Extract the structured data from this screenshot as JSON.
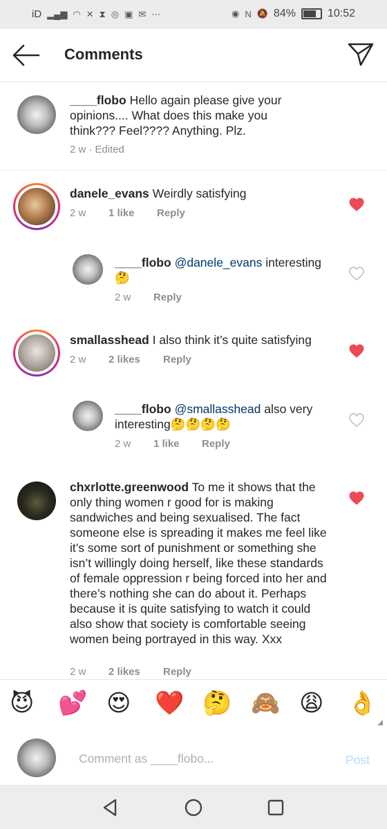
{
  "status_bar": {
    "left_text": "iD",
    "battery_percent": "84%",
    "time": "10:52",
    "battery_level": 0.84
  },
  "header": {
    "title": "Comments"
  },
  "caption": {
    "username": "____flobo",
    "text": "Hello again please give your opinions.... What does this make you think??? Feel???? Anything. Plz.",
    "time": "2 w",
    "edited": "Edited",
    "separator": "·"
  },
  "comments": [
    {
      "username": "danele_evans",
      "text": "Weirdly satisfying",
      "time": "2 w",
      "likes": "1 like",
      "reply": "Reply",
      "liked": true
    },
    {
      "username": "____flobo",
      "mention": "@danele_evans",
      "text": "interesting",
      "emoji": "🤔",
      "time": "2 w",
      "reply": "Reply",
      "liked": false
    },
    {
      "username": "smallasshead",
      "text": "I also think it’s quite satisfying",
      "time": "2 w",
      "likes": "2 likes",
      "reply": "Reply",
      "liked": true
    },
    {
      "username": "____flobo",
      "mention": "@smallasshead",
      "text": "also very interesting",
      "emoji": "🤔🤔🤔🤔",
      "time": "2 w",
      "likes": "1 like",
      "reply": "Reply",
      "liked": false
    },
    {
      "username": "chxrlotte.greenwood",
      "text": "To me it shows that the only thing women r good for is making sandwiches and being sexualised. The fact someone else is spreading it makes me feel like it’s some sort of punishment or something she isn’t willingly doing herself, like these standards of female oppression r being forced into her and there’s nothing she can do about it. Perhaps because it is quite satisfying to watch it could also show that society is comfortable seeing women being portrayed in this way. Xxx",
      "time": "2 w",
      "likes": "2 likes",
      "reply": "Reply",
      "liked": true
    }
  ],
  "emoji_bar": [
    "😈",
    "💕",
    "😍",
    "❤️",
    "🤔",
    "🙈",
    "😩",
    "👌"
  ],
  "composer": {
    "placeholder": "Comment as ____flobo...",
    "post_label": "Post"
  },
  "colors": {
    "heart_liked": "#ed4956",
    "heart_unliked": "#c7c7c7",
    "mention": "#00376b",
    "post_disabled": "#b3dbff"
  },
  "icons": {
    "back": "arrow-left-icon",
    "send": "direct-send-icon",
    "like": "heart-icon",
    "nav_back": "triangle-back-icon",
    "nav_home": "circle-home-icon",
    "nav_recent": "square-recents-icon"
  }
}
